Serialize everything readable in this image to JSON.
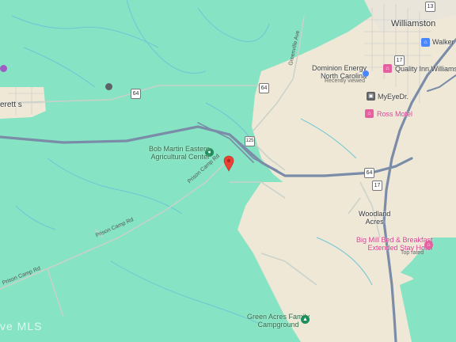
{
  "map": {
    "places": {
      "williamston": "Williamston",
      "woodland_acres": "Woodland\nAcres",
      "everetts": "erett s"
    },
    "pois": {
      "bob_martin": "Bob Martin Eastern\nAgricultural Center",
      "dominion": "Dominion Energy\nNorth Carolina",
      "dominion_note": "Recently viewed",
      "quality_inn": "Quality Inn Williamston",
      "walker": "Walker H",
      "myeyedr": "MyEyeDr.",
      "ross_motel": "Ross Motel",
      "big_mill": "Big Mill Bed & Breakfast\nExtended Stay Hotel",
      "big_mill_note": "Top rated",
      "green_acres": "Green Acres Family\nCampground"
    },
    "roads": {
      "prison_camp_1": "Prison Camp Rd",
      "prison_camp_2": "Prison Camp Rd",
      "prison_camp_3": "Prison Camp Rd",
      "greenville_ave": "Greenville Ave",
      "nc125_a": "125",
      "us64_a": "64",
      "us64_b": "64",
      "us64_c": "64",
      "us17_a": "17",
      "us17_b": "17",
      "us13_a": "13"
    },
    "watermark": "ve MLS",
    "colors": {
      "land": "#86e3c3",
      "urban": "#efe8d6",
      "highway": "#7a8ca8",
      "local_road": "#c9d2c9",
      "stream": "#6fc6d6",
      "marker": "#ea4335"
    }
  }
}
